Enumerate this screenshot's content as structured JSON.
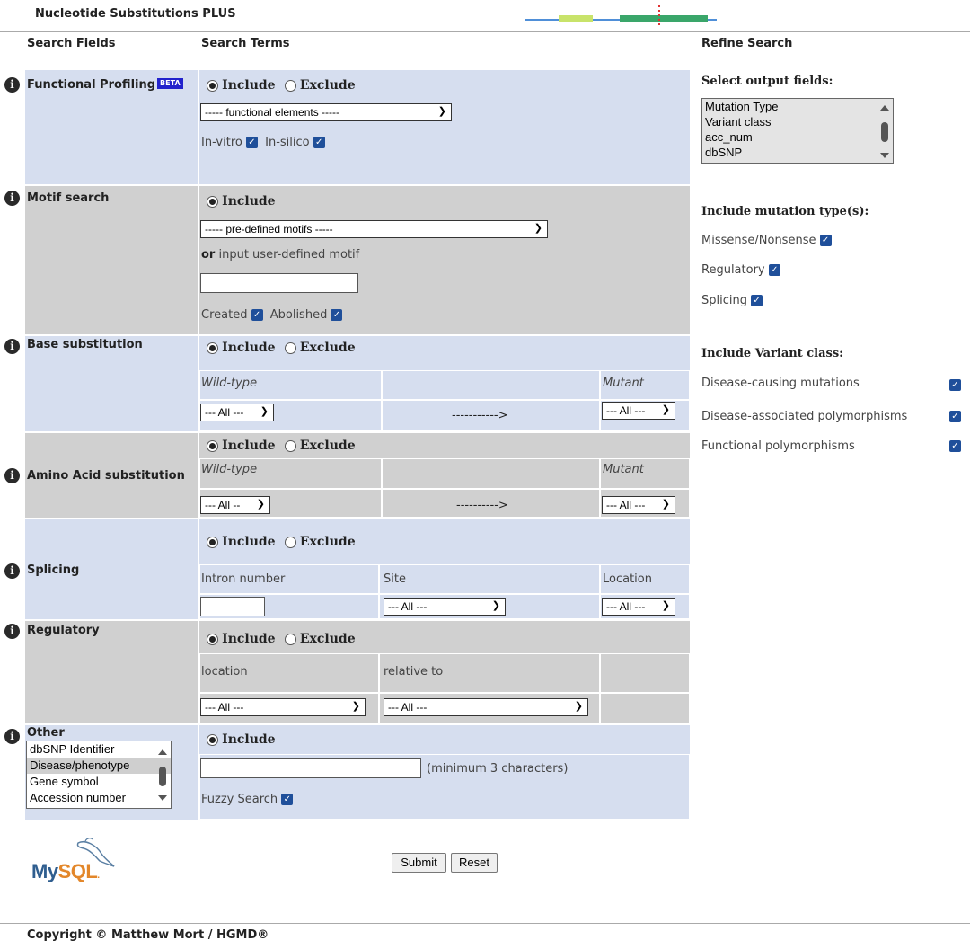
{
  "header": {
    "title": "Nucleotide Substitutions PLUS"
  },
  "columns": {
    "search_fields": "Search Fields",
    "search_terms": "Search Terms",
    "refine": "Refine Search"
  },
  "include": "Include",
  "exclude": "Exclude",
  "functional": {
    "label": "Functional Profiling",
    "badge": "BETA",
    "select": "----- functional elements -----",
    "invitro": "In-vitro",
    "insilico": "In-silico"
  },
  "motif": {
    "label": "Motif search",
    "select": "----- pre-defined motifs -----",
    "or": "or",
    "or_text": "input user-defined motif",
    "created": "Created",
    "abolished": "Abolished"
  },
  "base": {
    "label": "Base substitution",
    "wild": "Wild-type",
    "mutant": "Mutant",
    "arrow": "----------->",
    "all": "--- All ---"
  },
  "amino": {
    "label": "Amino Acid substitution",
    "wild": "Wild-type",
    "mutant": "Mutant",
    "arrow": "---------->",
    "all_left": "--- All --",
    "all_right": "--- All ---"
  },
  "splicing": {
    "label": "Splicing",
    "intron": "Intron number",
    "site": "Site",
    "location": "Location",
    "site_all": "--- All ---",
    "loc_all": "--- All ---"
  },
  "regulatory": {
    "label": "Regulatory",
    "location": "location",
    "relative": "relative to",
    "loc_all": "--- All ---",
    "rel_all": "--- All ---"
  },
  "other": {
    "label": "Other",
    "options": [
      "dbSNP Identifier",
      "Disease/phenotype",
      "Gene symbol",
      "Accession number"
    ],
    "hint": "(minimum 3 characters)",
    "fuzzy": "Fuzzy Search"
  },
  "buttons": {
    "submit": "Submit",
    "reset": "Reset"
  },
  "logo": {
    "text": "MySQL"
  },
  "refine": {
    "output_title": "Select output fields:",
    "output_options": [
      "Mutation Type",
      "Variant class",
      "acc_num",
      "dbSNP"
    ],
    "mut_title": "Include mutation type(s):",
    "mut_types": [
      "Missense/Nonsense",
      "Regulatory",
      "Splicing"
    ],
    "variant_title": "Include Variant class:",
    "variant_classes": [
      "Disease-causing mutations",
      "Disease-associated polymorphisms",
      "Functional polymorphisms"
    ]
  },
  "footer": {
    "copyright": "Copyright © Matthew Mort / HGMD®"
  },
  "colors": {
    "light_band": "#d6deef",
    "grey_band": "#d0d0d0",
    "checkbox": "#1f4f9a"
  }
}
